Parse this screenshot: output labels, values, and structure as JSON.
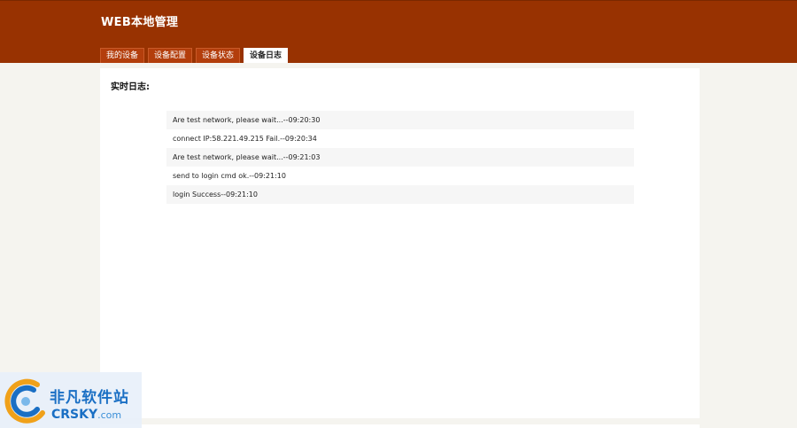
{
  "header": {
    "title": "WEB本地管理"
  },
  "tabs": [
    {
      "label": "我的设备",
      "active": false
    },
    {
      "label": "设备配置",
      "active": false
    },
    {
      "label": "设备状态",
      "active": false
    },
    {
      "label": "设备日志",
      "active": true
    }
  ],
  "main": {
    "section_title": "实时日志:",
    "log_lines": [
      "Are test network, please wait...--09:20:30",
      "connect IP:58.221.49.215 Fail.--09:20:34",
      "Are test network, please wait...--09:21:03",
      "send to login cmd ok.--09:21:10",
      "login Success--09:21:10"
    ]
  },
  "watermark": {
    "name_cn": "非凡软件站",
    "name_en_main": "CRSKY",
    "name_en_suffix": ".com"
  },
  "colors": {
    "header_bg": "#983201",
    "tab_bg": "#b33e0c",
    "page_bg": "#f5f4ef",
    "panel_bg": "#ffffff",
    "row_shade": "#f6f6f6"
  }
}
